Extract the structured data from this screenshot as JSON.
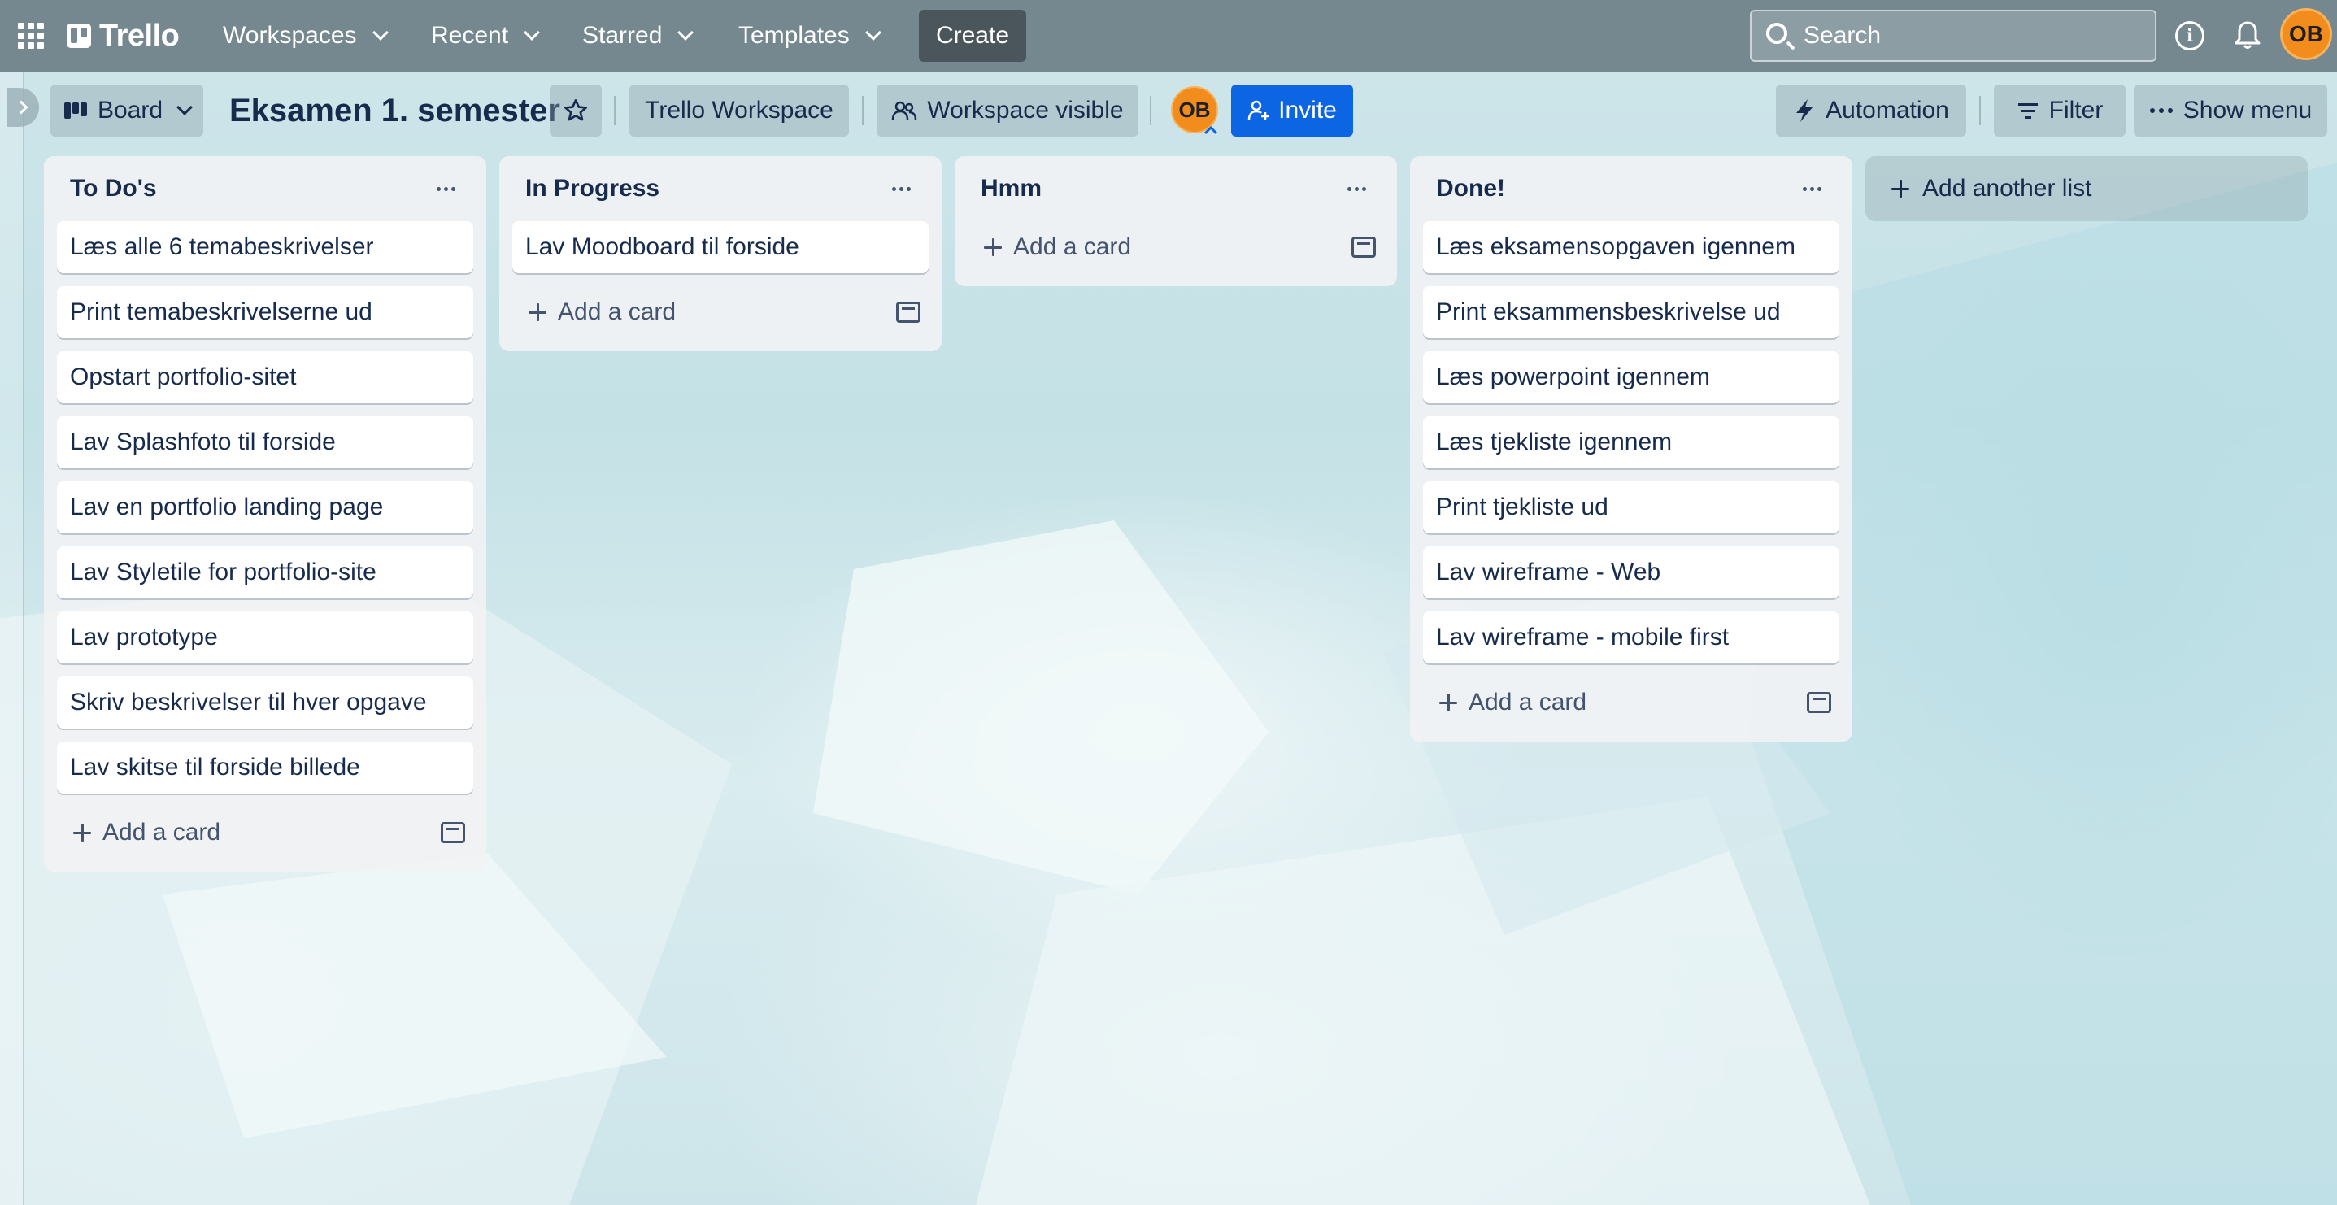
{
  "topbar": {
    "logo_text": "Trello",
    "menus": [
      {
        "label": "Workspaces"
      },
      {
        "label": "Recent"
      },
      {
        "label": "Starred"
      },
      {
        "label": "Templates"
      }
    ],
    "create_label": "Create",
    "search_placeholder": "Search",
    "user_initials": "OB"
  },
  "board_header": {
    "view_label": "Board",
    "title": "Eksamen 1. semester",
    "workspace_label": "Trello Workspace",
    "visibility_label": "Workspace visible",
    "member_initials": "OB",
    "invite_label": "Invite",
    "automation_label": "Automation",
    "filter_label": "Filter",
    "show_menu_label": "Show menu"
  },
  "lists": [
    {
      "title": "To Do's",
      "cards": [
        "Læs alle 6 temabeskrivelser",
        "Print temabeskrivelserne ud",
        "Opstart portfolio-sitet",
        "Lav Splashfoto til forside",
        "Lav en portfolio landing page",
        "Lav Styletile for portfolio-site",
        "Lav prototype",
        "Skriv beskrivelser til hver opgave",
        "Lav skitse til forside billede"
      ],
      "add_card_label": "Add a card"
    },
    {
      "title": "In Progress",
      "cards": [
        "Lav Moodboard til forside"
      ],
      "add_card_label": "Add a card"
    },
    {
      "title": "Hmm",
      "cards": [],
      "add_card_label": "Add a card"
    },
    {
      "title": "Done!",
      "cards": [
        "Læs eksamensopgaven igennem",
        "Print eksammensbeskrivelse ud",
        "Læs powerpoint igennem",
        "Læs tjekliste igennem",
        "Print tjekliste ud",
        "Lav wireframe - Web",
        "Lav wireframe - mobile first"
      ],
      "add_card_label": "Add a card"
    }
  ],
  "add_list_label": "Add another list",
  "colors": {
    "header_bg": "#6e8088",
    "invite_bg": "#0c66e4",
    "avatar_bg": "#f28c1d",
    "list_bg": "#f1f2f4"
  }
}
